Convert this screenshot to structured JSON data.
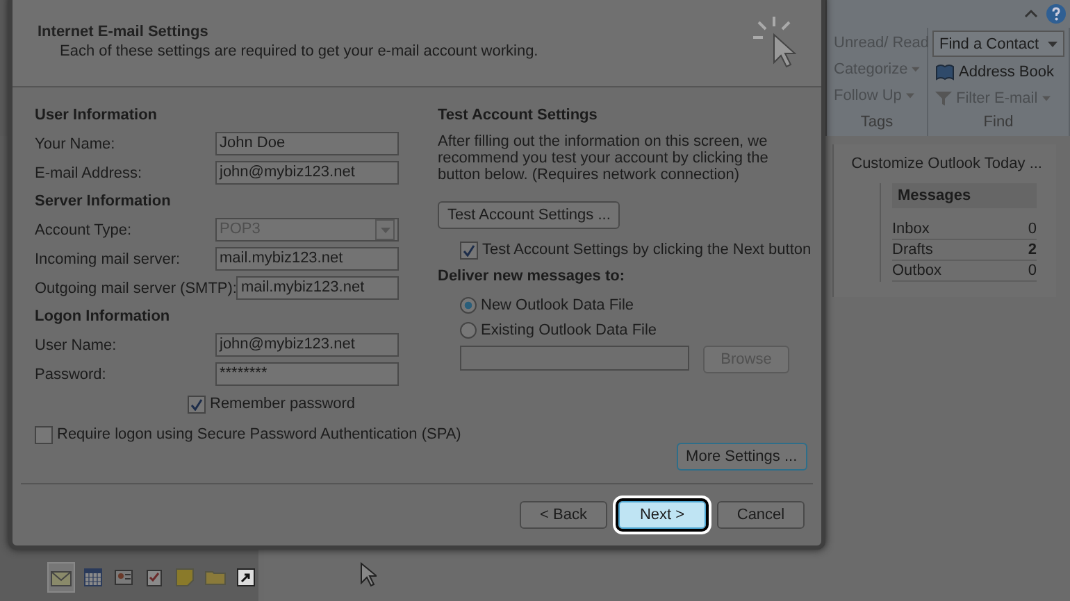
{
  "ribbon": {
    "groups": [
      {
        "label": "Tags",
        "items": [
          {
            "label": "Unread/ Read",
            "kind": "button"
          },
          {
            "label": "Categorize",
            "kind": "menu"
          },
          {
            "label": "Follow Up",
            "kind": "menu"
          }
        ]
      },
      {
        "label": "Find",
        "items": [
          {
            "label": "Find a Contact",
            "kind": "combo"
          },
          {
            "label": "Address Book",
            "kind": "book"
          },
          {
            "label": "Filter E-mail",
            "kind": "filter"
          }
        ]
      }
    ]
  },
  "outlook_today": {
    "customize_link": "Customize Outlook Today ...",
    "messages": {
      "title": "Messages",
      "rows": [
        {
          "name": "Inbox",
          "count": "0",
          "bold": false
        },
        {
          "name": "Drafts",
          "count": "2",
          "bold": true
        },
        {
          "name": "Outbox",
          "count": "0",
          "bold": false
        }
      ]
    }
  },
  "dialog": {
    "title": "Internet E-mail Settings",
    "subtitle": "Each of these settings are required to get your e-mail account working.",
    "sections": [
      {
        "heading": "User Information",
        "fields": [
          {
            "label": "Your Name:",
            "value": "John Doe",
            "kind": "text"
          },
          {
            "label": "E-mail Address:",
            "value": "john@mybiz123.net",
            "kind": "text"
          }
        ]
      },
      {
        "heading": "Server Information",
        "fields": [
          {
            "label": "Account Type:",
            "value": "POP3",
            "kind": "combo"
          },
          {
            "label": "Incoming mail server:",
            "value": "mail.mybiz123.net",
            "kind": "text"
          },
          {
            "label": "Outgoing mail server (SMTP):",
            "value": "mail.mybiz123.net",
            "kind": "text"
          }
        ]
      },
      {
        "heading": "Logon Information",
        "fields": [
          {
            "label": "User Name:",
            "value": "john@mybiz123.net",
            "kind": "text"
          },
          {
            "label": "Password:",
            "value": "********",
            "kind": "text"
          }
        ]
      }
    ],
    "remember_password": {
      "label": "Remember password",
      "checked": true
    },
    "spa": {
      "label": "Require logon using Secure Password Authentication (SPA)",
      "checked": false
    },
    "test": {
      "heading": "Test Account Settings",
      "description": "After filling out the information on this screen, we recommend you test your account by clicking the button below. (Requires network connection)",
      "button": "Test Account Settings ...",
      "checkbox": {
        "label": "Test Account Settings by clicking the Next button",
        "checked": true
      }
    },
    "deliver": {
      "heading": "Deliver new messages to:",
      "options": [
        {
          "label": "New Outlook Data File",
          "selected": true
        },
        {
          "label": "Existing Outlook Data File",
          "selected": false
        }
      ],
      "browse": {
        "label": "Browse",
        "disabled": true
      }
    },
    "more_settings": "More Settings ...",
    "buttons": [
      {
        "label": "< Back",
        "default": false
      },
      {
        "label": "Next >",
        "default": true
      },
      {
        "label": "Cancel",
        "default": false
      }
    ]
  }
}
